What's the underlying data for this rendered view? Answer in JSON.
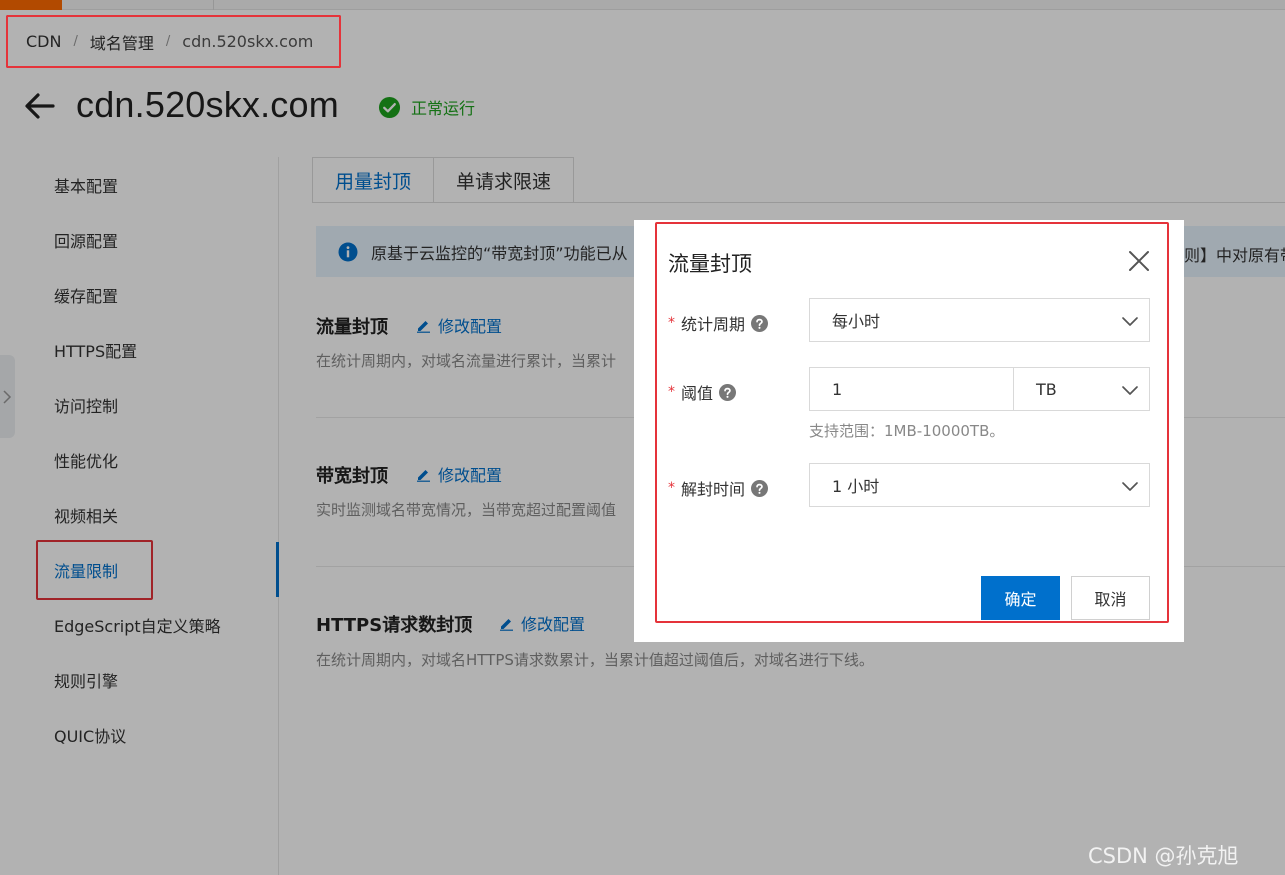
{
  "breadcrumb": {
    "items": [
      "CDN",
      "域名管理",
      "cdn.520skx.com"
    ],
    "separator": "/"
  },
  "header": {
    "title": "cdn.520skx.com",
    "status": "正常运行",
    "status_color": "#1ea21e"
  },
  "sidebar": {
    "items": [
      "基本配置",
      "回源配置",
      "缓存配置",
      "HTTPS配置",
      "访问控制",
      "性能优化",
      "视频相关",
      "流量限制",
      "EdgeScript自定义策略",
      "规则引擎",
      "QUIC协议"
    ],
    "active": "流量限制"
  },
  "tabs": [
    "用量封顶",
    "单请求限速"
  ],
  "banner": {
    "text": "原基于云监控的“带宽封顶”功能已从",
    "text_right": "则】中对原有带"
  },
  "sections": [
    {
      "title": "流量封顶",
      "edit_label": "修改配置",
      "desc": "在统计周期内，对域名流量进行累计，当累计"
    },
    {
      "title": "带宽封顶",
      "edit_label": "修改配置",
      "desc": "实时监测域名带宽情况，当带宽超过配置阈值"
    },
    {
      "title": "HTTPS请求数封顶",
      "edit_label": "修改配置",
      "desc": "在统计周期内，对域名HTTPS请求数累计，当累计值超过阈值后，对域名进行下线。"
    }
  ],
  "dialog": {
    "title": "流量封顶",
    "required_mark": "*",
    "period": {
      "label": "统计周期",
      "value": "每小时"
    },
    "threshold": {
      "label": "阈值",
      "value": "1",
      "unit": "TB",
      "hint": "支持范围：1MB-10000TB。"
    },
    "unblock": {
      "label": "解封时间",
      "value": "1 小时"
    },
    "ok_label": "确定",
    "cancel_label": "取消"
  },
  "colors": {
    "primary": "#0070cc",
    "highlight": "#e5333a",
    "brand": "#ff6a00"
  },
  "watermark": "CSDN @孙克旭"
}
